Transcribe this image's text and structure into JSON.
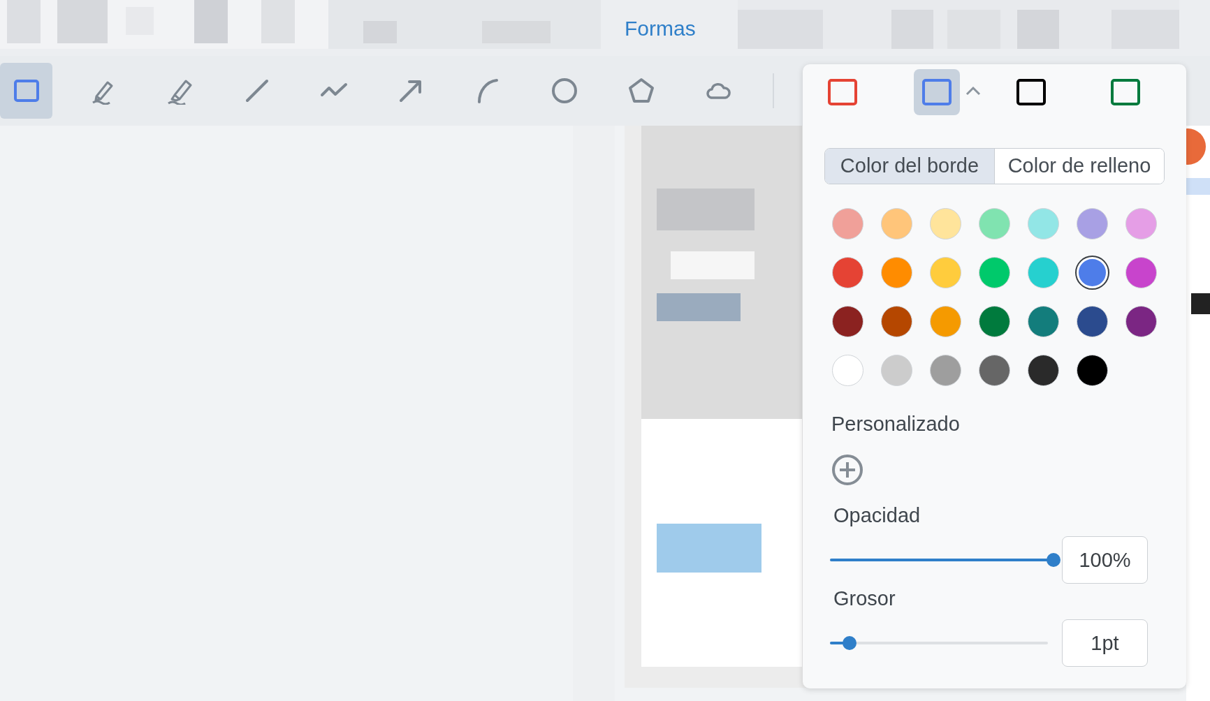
{
  "header": {
    "title": "Formas"
  },
  "tools": [
    {
      "kind": "rectangle",
      "selected": true
    },
    {
      "kind": "pen",
      "selected": false
    },
    {
      "kind": "highlighter",
      "selected": false
    },
    {
      "kind": "line",
      "selected": false
    },
    {
      "kind": "polyline",
      "selected": false
    },
    {
      "kind": "arrow",
      "selected": false
    },
    {
      "kind": "arc",
      "selected": false
    },
    {
      "kind": "circle",
      "selected": false
    },
    {
      "kind": "polygon",
      "selected": false
    },
    {
      "kind": "cloud",
      "selected": false
    }
  ],
  "style_panel": {
    "presets": [
      {
        "color": "#e54334",
        "selected": false
      },
      {
        "color": "#4e7de9",
        "selected": true
      },
      {
        "color": "#000000",
        "selected": false
      },
      {
        "color": "#007a3d",
        "selected": false
      }
    ],
    "tabs": [
      {
        "label": "Color del borde",
        "selected": true
      },
      {
        "label": "Color de relleno",
        "selected": false
      }
    ],
    "swatches": [
      {
        "color": "#f0a099",
        "selected": false
      },
      {
        "color": "#ffc57a",
        "selected": false
      },
      {
        "color": "#ffe49b",
        "selected": false
      },
      {
        "color": "#80e3b0",
        "selected": false
      },
      {
        "color": "#92e6e6",
        "selected": false
      },
      {
        "color": "#a8a0e4",
        "selected": false
      },
      {
        "color": "#e59ee6",
        "selected": false
      },
      {
        "color": "#e54334",
        "selected": false
      },
      {
        "color": "#ff8c00",
        "selected": false
      },
      {
        "color": "#ffcc3d",
        "selected": false
      },
      {
        "color": "#00c96b",
        "selected": false
      },
      {
        "color": "#26d0cf",
        "selected": false
      },
      {
        "color": "#4e7de9",
        "selected": true
      },
      {
        "color": "#c844cc",
        "selected": false
      },
      {
        "color": "#8b2220",
        "selected": false
      },
      {
        "color": "#b54700",
        "selected": false
      },
      {
        "color": "#f59a00",
        "selected": false
      },
      {
        "color": "#007a3d",
        "selected": false
      },
      {
        "color": "#137d7c",
        "selected": false
      },
      {
        "color": "#2b4b8e",
        "selected": false
      },
      {
        "color": "#7b2683",
        "selected": false
      },
      {
        "color": "#ffffff",
        "selected": false
      },
      {
        "color": "#cccccc",
        "selected": false
      },
      {
        "color": "#9e9e9e",
        "selected": false
      },
      {
        "color": "#666666",
        "selected": false
      },
      {
        "color": "#2a2a2a",
        "selected": false
      },
      {
        "color": "#000000",
        "selected": false
      }
    ],
    "custom_label": "Personalizado",
    "opacity": {
      "label": "Opacidad",
      "level": 1,
      "value": "100%"
    },
    "thickness": {
      "label": "Grosor",
      "level": 0.09,
      "value": "1pt"
    }
  }
}
